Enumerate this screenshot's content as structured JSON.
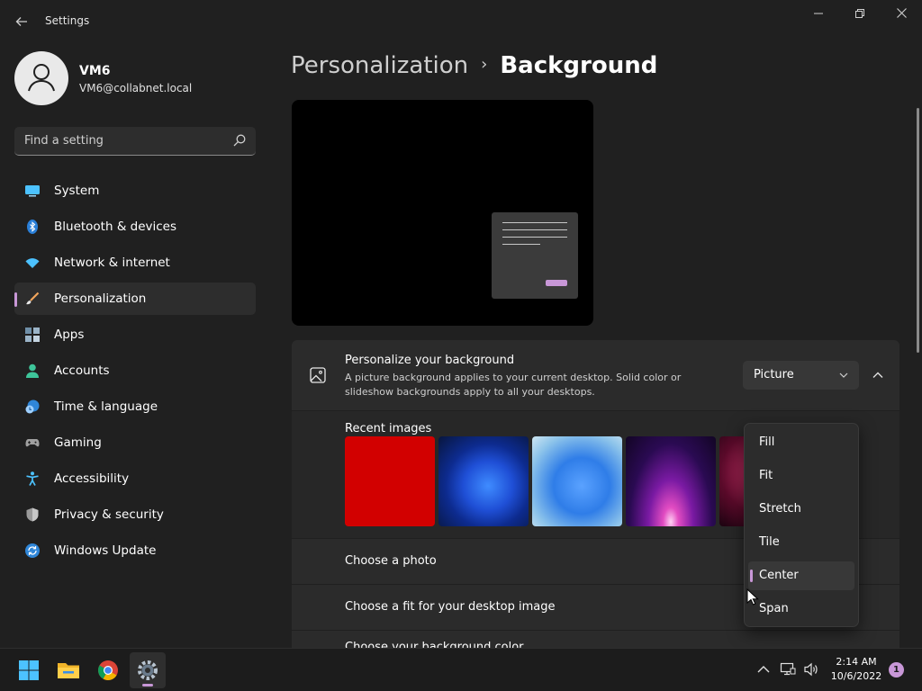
{
  "window": {
    "title": "Settings",
    "back_icon": "arrow-left-icon",
    "controls": [
      "minimize-icon",
      "restore-icon",
      "close-icon"
    ]
  },
  "profile": {
    "name": "VM6",
    "email": "VM6@collabnet.local",
    "avatar_icon": "person-icon"
  },
  "search": {
    "placeholder": "Find a setting",
    "icon": "search-icon"
  },
  "sidebar": {
    "items": [
      {
        "label": "System",
        "icon": "monitor-icon"
      },
      {
        "label": "Bluetooth & devices",
        "icon": "bluetooth-icon"
      },
      {
        "label": "Network & internet",
        "icon": "wifi-icon"
      },
      {
        "label": "Personalization",
        "icon": "brush-icon",
        "active": true
      },
      {
        "label": "Apps",
        "icon": "apps-icon"
      },
      {
        "label": "Accounts",
        "icon": "account-icon"
      },
      {
        "label": "Time & language",
        "icon": "clock-globe-icon"
      },
      {
        "label": "Gaming",
        "icon": "gamepad-icon"
      },
      {
        "label": "Accessibility",
        "icon": "accessibility-icon"
      },
      {
        "label": "Privacy & security",
        "icon": "shield-icon"
      },
      {
        "label": "Windows Update",
        "icon": "update-icon"
      }
    ]
  },
  "breadcrumb": {
    "parent": "Personalization",
    "separator": "›",
    "current": "Background"
  },
  "background_card": {
    "icon": "image-icon",
    "title": "Personalize your background",
    "description": "A picture background applies to your current desktop. Solid color or slideshow backgrounds apply to all your desktops.",
    "select_value": "Picture"
  },
  "recent_images": {
    "label": "Recent images",
    "items": [
      "solid-red",
      "blue-bloom-dark",
      "blue-bloom-light",
      "purple-glow",
      "pink-flower"
    ]
  },
  "rows": {
    "choose_photo": "Choose a photo",
    "choose_fit": "Choose a fit for your desktop image",
    "choose_color": "Choose your background color"
  },
  "fit_menu": {
    "options": [
      "Fill",
      "Fit",
      "Stretch",
      "Tile",
      "Center",
      "Span"
    ],
    "selected": "Center"
  },
  "taskbar": {
    "apps": [
      {
        "name": "start",
        "icon": "windows-logo-icon"
      },
      {
        "name": "file-explorer",
        "icon": "folder-icon"
      },
      {
        "name": "chrome",
        "icon": "chrome-icon"
      },
      {
        "name": "settings",
        "icon": "gear-icon",
        "active": true
      }
    ],
    "tray": [
      "chevron-up-icon",
      "network-icon",
      "volume-icon"
    ],
    "time": "2:14 AM",
    "date": "10/6/2022",
    "notification_count": "1"
  },
  "colors": {
    "accent": "#c897d7",
    "background": "#202020",
    "card": "#2b2b2b"
  }
}
